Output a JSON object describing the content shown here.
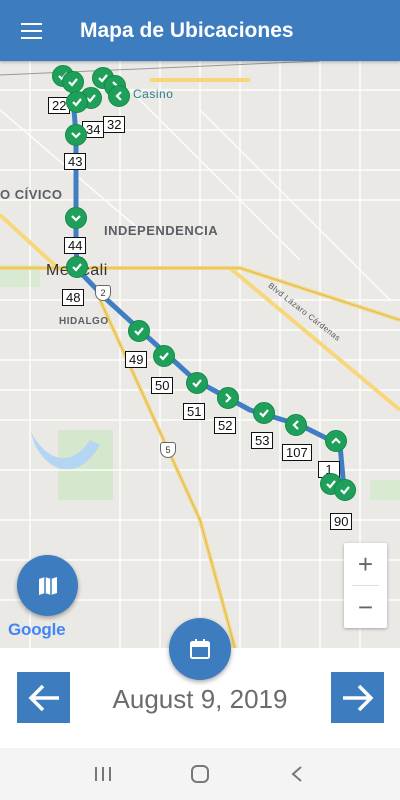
{
  "app": {
    "title": "Mapa de Ubicaciones"
  },
  "map": {
    "area_labels": {
      "civico": "O CÍVICO",
      "independencia": "INDEPENDENCIA",
      "city": "Mexicali",
      "hidalgo": "HIDALGO",
      "poi": "a Casino",
      "road": "Blvd Lázaro Cárdenas"
    },
    "highway_shields": [
      "2",
      "5"
    ],
    "stop_labels": [
      "22",
      "34",
      "32",
      "43",
      "44",
      "48",
      "49",
      "50",
      "51",
      "52",
      "53",
      "107",
      "1",
      "90"
    ],
    "attribution": "Google",
    "zoom_in_label": "+",
    "zoom_out_label": "−"
  },
  "datebar": {
    "date": "August 9, 2019",
    "prev_icon": "arrow-left-icon",
    "next_icon": "arrow-right-icon"
  },
  "colors": {
    "primary": "#3d7dbf",
    "pin": "#1fa05a",
    "route": "#3f7ec2"
  }
}
